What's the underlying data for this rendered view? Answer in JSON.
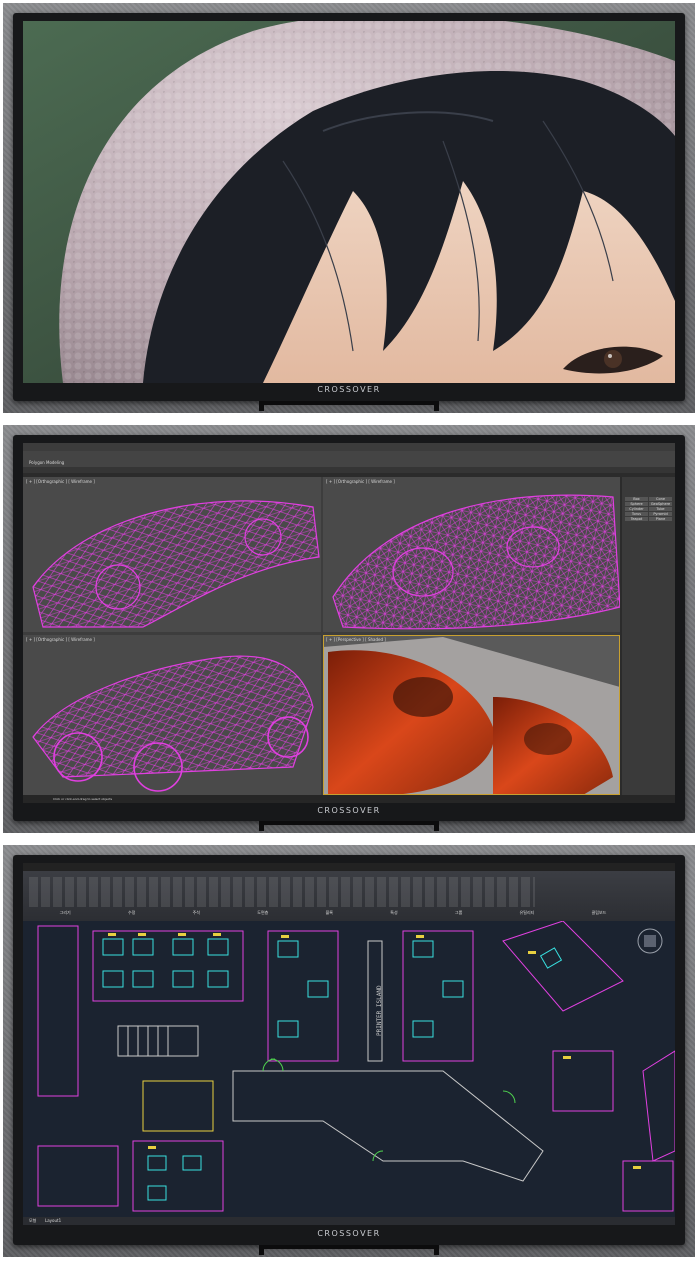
{
  "brand": "CROSSOVER",
  "colors": {
    "bezel": "#17181a",
    "wireframe": "#e03fe0",
    "cad_background": "#1b2330",
    "cad_cyan": "#38e0e0",
    "cad_magenta": "#e040e0",
    "cad_yellow": "#e8d040",
    "render_orange": "#d9471a"
  },
  "panel_photo": {
    "subject": "closeup-face-knit-hat-photo"
  },
  "panel_3d": {
    "status_prompt": "Click or click-and-drag to select objects",
    "ribbon_tab_label": "Polygon Modeling",
    "command_panel_buttons": [
      "Box",
      "Cone",
      "Sphere",
      "GeoSphere",
      "Cylinder",
      "Tube",
      "Torus",
      "Pyramid",
      "Teapot",
      "Plane"
    ],
    "viewports": [
      {
        "label": "[ + ] [Orthographic ] [ Wireframe ]",
        "mode": "wireframe"
      },
      {
        "label": "[ + ] [Orthographic ] [ Wireframe ]",
        "mode": "wireframe"
      },
      {
        "label": "[ + ] [Orthographic ] [ Wireframe ]",
        "mode": "wireframe"
      },
      {
        "label": "[ + ] [Perspective ] [ Shaded ]",
        "mode": "shaded"
      }
    ]
  },
  "panel_cad": {
    "printer_island_label": "PRINTER ISLAND",
    "layout_tabs": [
      "모형",
      "Layout1"
    ],
    "ribbon_groups": [
      "그리기",
      "수정",
      "주석",
      "도면층",
      "블록",
      "특성",
      "그룹",
      "유틸리티",
      "클립보드"
    ]
  }
}
